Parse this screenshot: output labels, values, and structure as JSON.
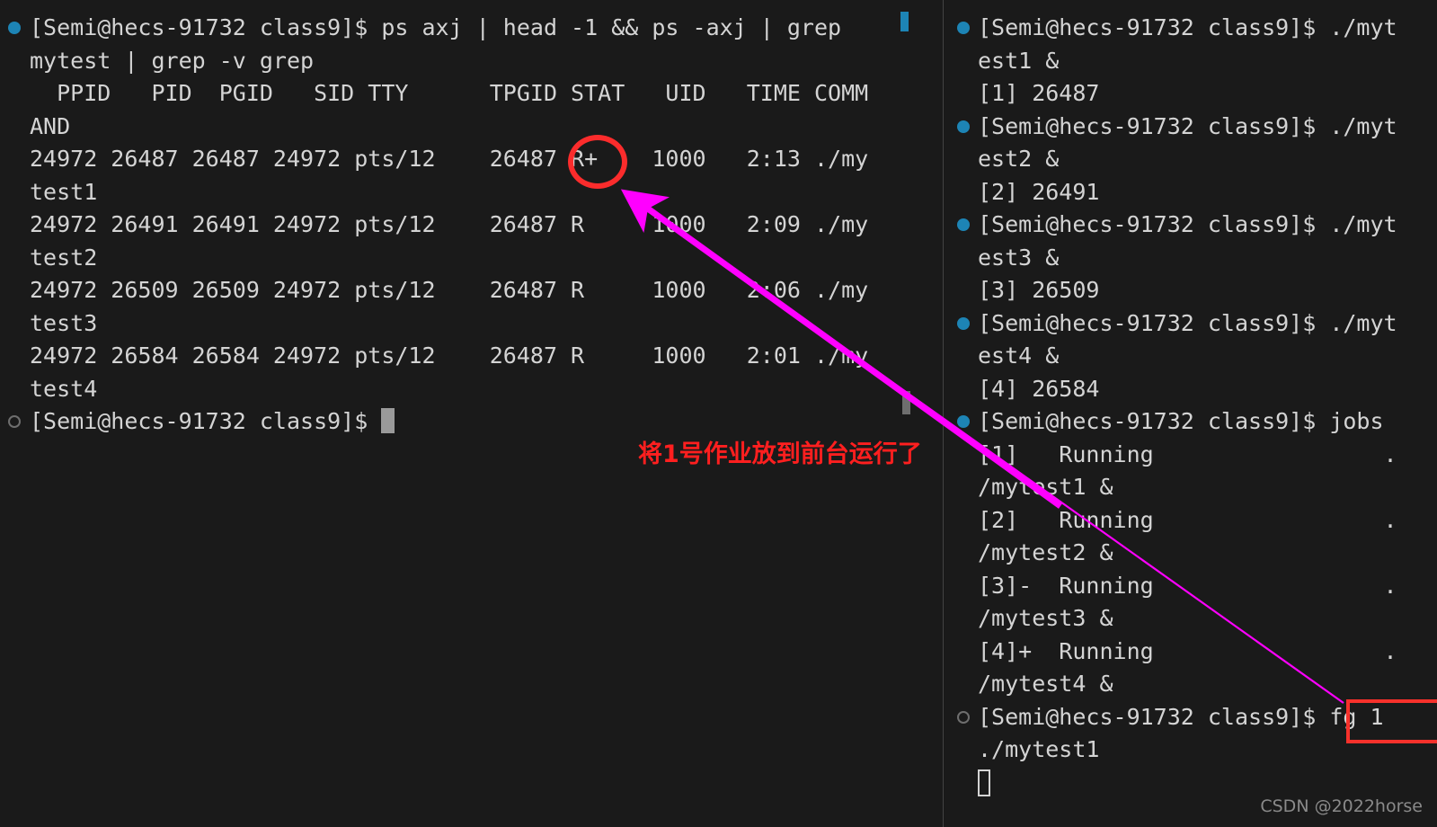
{
  "colors": {
    "background": "#1a1a1a",
    "text": "#d4d4d4",
    "marker_active": "#1d84b5",
    "marker_inactive": "#6e6e6e",
    "annotation_red": "#ff1f1f",
    "circle_red": "#fb2c2c",
    "box_red": "#f7312b",
    "arrow_magenta": "#ff00ff",
    "divider": "#434343",
    "watermark": "#8a8a8a"
  },
  "left_pane": {
    "name": "ps-output-terminal",
    "lines": [
      {
        "marker": "filled",
        "rows": [
          "[Semi@hecs-91732 class9]$ ps axj | head -1 && ps -axj | grep",
          "mytest | grep -v grep"
        ]
      },
      {
        "marker": "none",
        "rows": [
          "  PPID   PID  PGID   SID TTY      TPGID STAT   UID   TIME COMM",
          "AND"
        ]
      },
      {
        "marker": "none",
        "rows": [
          "24972 26487 26487 24972 pts/12    26487 R+    1000   2:13 ./my",
          "test1"
        ]
      },
      {
        "marker": "none",
        "rows": [
          "24972 26491 26491 24972 pts/12    26487 R     1000   2:09 ./my",
          "test2"
        ]
      },
      {
        "marker": "none",
        "rows": [
          "24972 26509 26509 24972 pts/12    26487 R     1000   2:06 ./my",
          "test3"
        ]
      },
      {
        "marker": "none",
        "rows": [
          "24972 26584 26584 24972 pts/12    26487 R     1000   2:01 ./my",
          "test4"
        ]
      },
      {
        "marker": "hollow",
        "rows": [
          "[Semi@hecs-91732 class9]$ "
        ],
        "cursor": true
      }
    ]
  },
  "right_pane": {
    "name": "jobs-terminal",
    "lines": [
      {
        "marker": "filled",
        "rows": [
          "[Semi@hecs-91732 class9]$ ./myt",
          "est1 &"
        ]
      },
      {
        "marker": "none",
        "rows": [
          "[1] 26487"
        ]
      },
      {
        "marker": "filled",
        "rows": [
          "[Semi@hecs-91732 class9]$ ./myt",
          "est2 &"
        ]
      },
      {
        "marker": "none",
        "rows": [
          "[2] 26491"
        ]
      },
      {
        "marker": "filled",
        "rows": [
          "[Semi@hecs-91732 class9]$ ./myt",
          "est3 &"
        ]
      },
      {
        "marker": "none",
        "rows": [
          "[3] 26509"
        ]
      },
      {
        "marker": "filled",
        "rows": [
          "[Semi@hecs-91732 class9]$ ./myt",
          "est4 &"
        ]
      },
      {
        "marker": "none",
        "rows": [
          "[4] 26584"
        ]
      },
      {
        "marker": "filled",
        "rows": [
          "[Semi@hecs-91732 class9]$ jobs"
        ]
      },
      {
        "marker": "none",
        "rows": [
          "[1]   Running                 .",
          "/mytest1 &"
        ]
      },
      {
        "marker": "none",
        "rows": [
          "[2]   Running                 .",
          "/mytest2 &"
        ]
      },
      {
        "marker": "none",
        "rows": [
          "[3]-  Running                 .",
          "/mytest3 &"
        ]
      },
      {
        "marker": "none",
        "rows": [
          "[4]+  Running                 .",
          "/mytest4 &"
        ]
      },
      {
        "marker": "hollow",
        "rows": [
          "[Semi@hecs-91732 class9]$ fg 1",
          "./mytest1"
        ]
      },
      {
        "marker": "none",
        "rows": [
          ""
        ],
        "boxglyph": true
      }
    ]
  },
  "annotations": {
    "chinese_note": "将1号作业放到前台运行了",
    "highlighted_state": "R+",
    "highlighted_command": "fg 1"
  },
  "watermark": {
    "text": "CSDN @2022horse"
  }
}
